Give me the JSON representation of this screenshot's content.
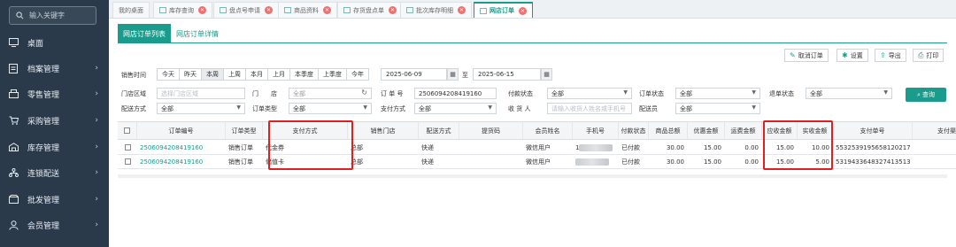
{
  "sidebar": {
    "search_placeholder": "输入关键字",
    "items": [
      {
        "label": "桌面",
        "icon": "monitor-icon",
        "arrow": false
      },
      {
        "label": "档案管理",
        "icon": "file-icon",
        "arrow": true
      },
      {
        "label": "零售管理",
        "icon": "cash-register-icon",
        "arrow": true
      },
      {
        "label": "采购管理",
        "icon": "cart-icon",
        "arrow": true
      },
      {
        "label": "库存管理",
        "icon": "warehouse-icon",
        "arrow": true
      },
      {
        "label": "连锁配送",
        "icon": "network-icon",
        "arrow": true
      },
      {
        "label": "批发管理",
        "icon": "package-icon",
        "arrow": true
      },
      {
        "label": "会员管理",
        "icon": "user-icon",
        "arrow": true
      }
    ]
  },
  "tabs": [
    {
      "label": "我的桌面"
    },
    {
      "label": "库存查询"
    },
    {
      "label": "盘点号申请"
    },
    {
      "label": "商品资料"
    },
    {
      "label": "存货盘点单"
    },
    {
      "label": "批次库存明细"
    },
    {
      "label": "网店订单"
    }
  ],
  "subtabs": [
    "网店订单列表",
    "网店订单详情"
  ],
  "toolbar": {
    "cancel": "取消订单",
    "settings": "设置",
    "export": "导出",
    "print": "打印",
    "query": "查询"
  },
  "filters": {
    "sale_time_label": "销售时间",
    "periods": [
      "今天",
      "昨天",
      "本周",
      "上周",
      "本月",
      "上月",
      "本季度",
      "上季度",
      "今年"
    ],
    "active_period": "本周",
    "date_from": "2025-06-09",
    "date_to_sep": "至",
    "date_to": "2025-06-15",
    "store_area_label": "门店区域",
    "store_area_placeholder": "选择门店区域",
    "store_label": "门　　店",
    "store_value": "全部",
    "order_no_label": "订 单 号",
    "order_no_value": "2506094208419160",
    "pay_status_label": "付款状态",
    "pay_status_value": "全部",
    "order_status_label": "订单状态",
    "order_status_value": "全部",
    "refund_status_label": "退单状态",
    "refund_status_value": "全部",
    "delivery_label": "配送方式",
    "delivery_value": "全部",
    "order_type_label": "订单类型",
    "order_type_value": "全部",
    "pay_method_label": "支付方式",
    "pay_method_value": "全部",
    "receiver_label": "收 货 人",
    "receiver_placeholder": "请输入收货人姓名或手机号",
    "deliverer_label": "配送员",
    "deliverer_value": "全部"
  },
  "table": {
    "headers": [
      "订单编号",
      "订单类型",
      "支付方式",
      "销售门店",
      "配送方式",
      "提货码",
      "会员姓名",
      "手机号",
      "付款状态",
      "商品总额",
      "优惠金额",
      "运费金额",
      "应收金额",
      "实收金额",
      "支付单号",
      "支付渠"
    ],
    "rows": [
      {
        "order_no": "2506094208419160",
        "type": "销售订单",
        "pay": "代金券",
        "store": "总部",
        "delivery": "快递",
        "pickup": "",
        "member": "微信用户",
        "phone_prefix": "1",
        "pay_status": "已付款",
        "total": "30.00",
        "discount": "15.00",
        "freight": "0.00",
        "receivable": "15.00",
        "received": "10.00",
        "pay_no": "5532539195658120217"
      },
      {
        "order_no": "2506094208419160",
        "type": "销售订单",
        "pay": "储值卡",
        "store": "总部",
        "delivery": "快递",
        "pickup": "",
        "member": "微信用户",
        "phone_prefix": "",
        "pay_status": "已付款",
        "total": "30.00",
        "discount": "15.00",
        "freight": "0.00",
        "receivable": "15.00",
        "received": "5.00",
        "pay_no": "5319433648327413513"
      }
    ]
  },
  "colors": {
    "accent": "#1a9b8b",
    "sidebar": "#2b3a4a",
    "highlight": "#e02020"
  }
}
